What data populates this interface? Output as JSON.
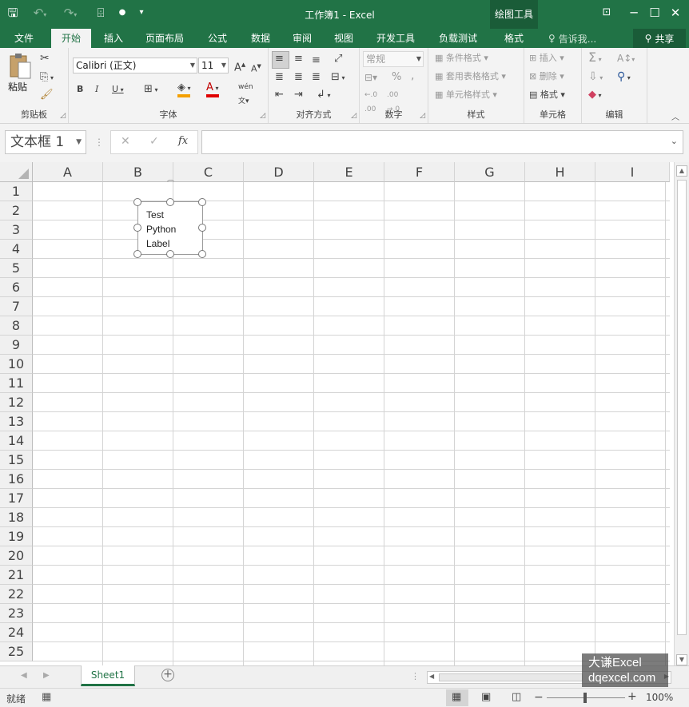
{
  "window": {
    "title": "工作簿1 - Excel",
    "context_tab_group": "绘图工具"
  },
  "tabs": [
    {
      "label": "文件"
    },
    {
      "label": "开始",
      "active": true
    },
    {
      "label": "插入"
    },
    {
      "label": "页面布局"
    },
    {
      "label": "公式"
    },
    {
      "label": "数据"
    },
    {
      "label": "审阅"
    },
    {
      "label": "视图"
    },
    {
      "label": "开发工具"
    },
    {
      "label": "负载测试"
    },
    {
      "label": "格式"
    }
  ],
  "tellme": "告诉我...",
  "share": "共享",
  "ribbon": {
    "clipboard": {
      "label": "剪贴板",
      "paste": "粘贴"
    },
    "font": {
      "label": "字体",
      "name": "Calibri (正文)",
      "size": "11",
      "bold": "B",
      "italic": "I",
      "underline": "U",
      "grow": "A",
      "shrink": "A",
      "phonetic": "wén"
    },
    "alignment": {
      "label": "对齐方式"
    },
    "number": {
      "label": "数字",
      "format": "常规",
      "percent": "%",
      "comma": ","
    },
    "styles": {
      "label": "样式",
      "conditional": "条件格式",
      "table": "套用表格格式",
      "cell": "单元格样式"
    },
    "cells": {
      "label": "单元格",
      "insert": "插入",
      "delete": "删除",
      "format": "格式"
    },
    "editing": {
      "label": "编辑"
    }
  },
  "formula_bar": {
    "name_box": "文本框 1",
    "fx": "fx",
    "value": ""
  },
  "columns": [
    "A",
    "B",
    "C",
    "D",
    "E",
    "F",
    "G",
    "H",
    "I"
  ],
  "rows": [
    "1",
    "2",
    "3",
    "4",
    "5",
    "6",
    "7",
    "8",
    "9",
    "10",
    "11",
    "12",
    "13",
    "14",
    "15",
    "16",
    "17",
    "18",
    "19",
    "20",
    "21",
    "22",
    "23",
    "24",
    "25"
  ],
  "textbox": {
    "lines": [
      "Test",
      "Python",
      "Label"
    ]
  },
  "sheet_tabs": [
    {
      "label": "Sheet1",
      "active": true
    }
  ],
  "status": {
    "ready": "就绪",
    "zoom": "100%"
  },
  "watermark": {
    "line1": "大谦Excel",
    "line2": "dqexcel.com"
  },
  "colors": {
    "accent": "#217346",
    "ribbon_bg": "#f3f3f3",
    "grid": "#d4d4d4"
  }
}
